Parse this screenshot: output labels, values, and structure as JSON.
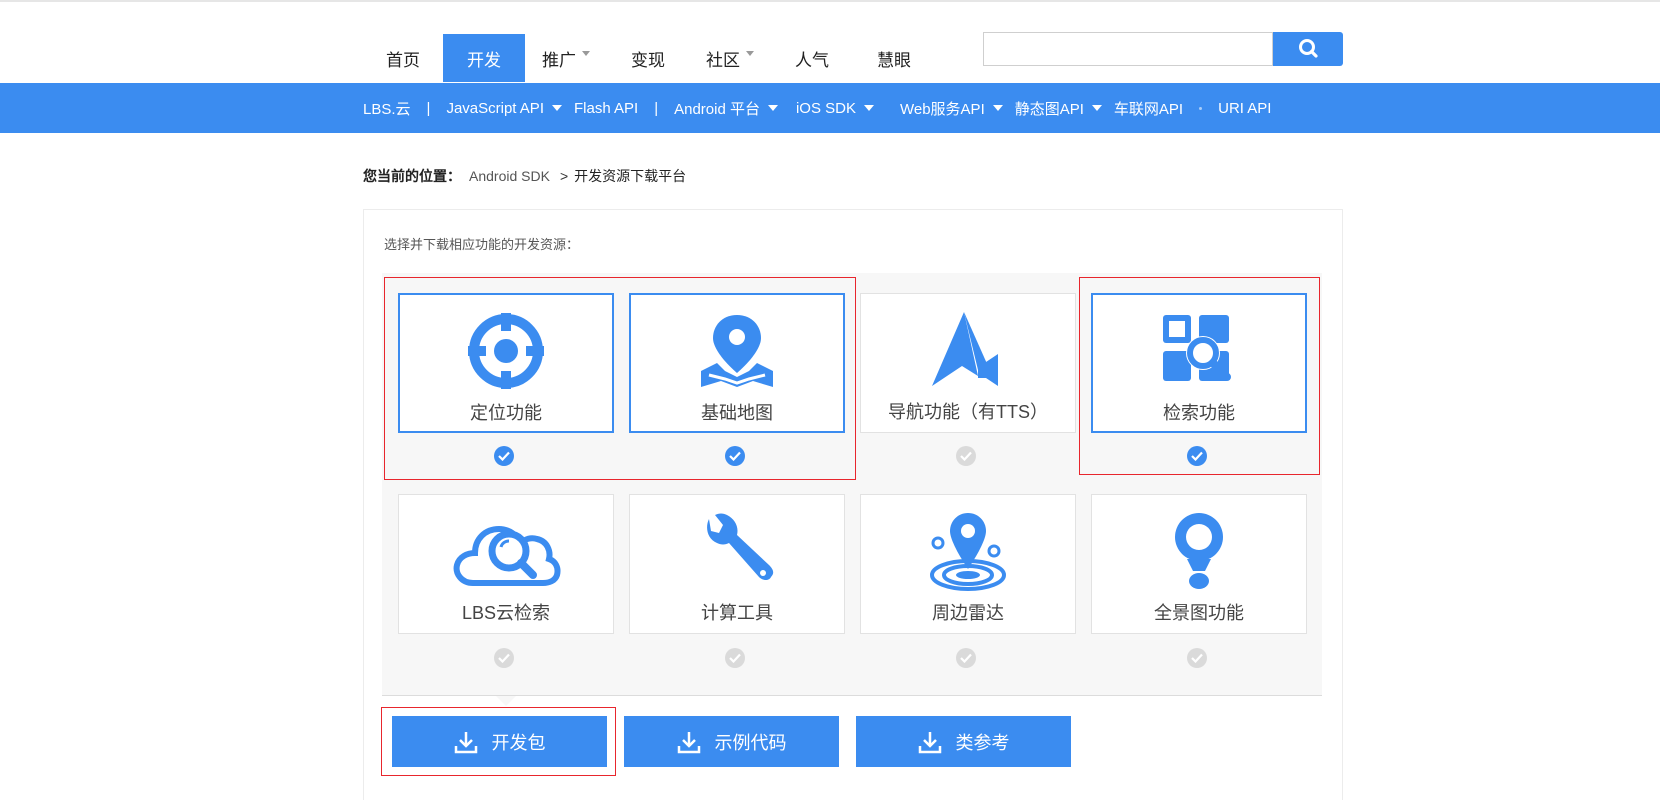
{
  "nav": {
    "items": [
      {
        "label": "首页",
        "active": false,
        "caret": false
      },
      {
        "label": "开发",
        "active": true,
        "caret": false
      },
      {
        "label": "推广",
        "active": false,
        "caret": true
      },
      {
        "label": "变现",
        "active": false,
        "caret": false
      },
      {
        "label": "社区",
        "active": false,
        "caret": true
      },
      {
        "label": "人气",
        "active": false,
        "caret": false
      },
      {
        "label": "慧眼",
        "active": false,
        "caret": false
      }
    ],
    "search_value": "",
    "search_icon": "search-icon"
  },
  "subnav": {
    "items": [
      {
        "label": "LBS.云"
      },
      {
        "label": "JavaScript API"
      },
      {
        "label": "Flash API"
      },
      {
        "label": "Android 平台"
      },
      {
        "label": "iOS SDK"
      },
      {
        "label": "Web服务API"
      },
      {
        "label": "静态图API"
      },
      {
        "label": "车联网API"
      },
      {
        "label": "URI API"
      }
    ],
    "separator": "|"
  },
  "breadcrumb": {
    "label": "您当前的位置：",
    "link": "Android SDK",
    "sep": ">",
    "current": "开发资源下载平台"
  },
  "panel": {
    "title": "选择并下载相应功能的开发资源："
  },
  "features": [
    {
      "label": "定位功能",
      "icon": "location-target-icon",
      "selected": true
    },
    {
      "label": "基础地图",
      "icon": "map-pin-icon",
      "selected": true
    },
    {
      "label": "导航功能（有TTS）",
      "icon": "navigation-arrow-icon",
      "selected": false
    },
    {
      "label": "检索功能",
      "icon": "search-grid-icon",
      "selected": true
    },
    {
      "label": "LBS云检索",
      "icon": "cloud-search-icon",
      "selected": false
    },
    {
      "label": "计算工具",
      "icon": "wrench-icon",
      "selected": false
    },
    {
      "label": "周边雷达",
      "icon": "radar-pin-icon",
      "selected": false
    },
    {
      "label": "全景图功能",
      "icon": "panorama-pin-icon",
      "selected": false
    }
  ],
  "downloads": [
    {
      "label": "开发包",
      "icon": "download-icon"
    },
    {
      "label": "示例代码",
      "icon": "download-icon"
    },
    {
      "label": "类参考",
      "icon": "download-icon"
    }
  ],
  "colors": {
    "accent": "#3b8cf0",
    "highlight": "#e8262d",
    "unchecked": "#dadada"
  }
}
